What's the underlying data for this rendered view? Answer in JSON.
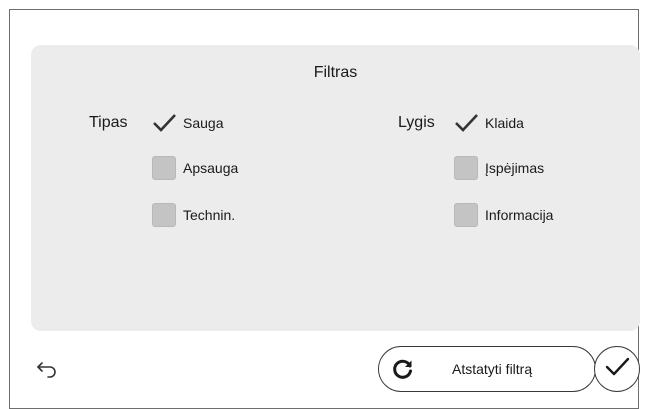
{
  "filter": {
    "title": "Filtras",
    "type_group": {
      "label": "Tipas",
      "options": [
        {
          "label": "Sauga",
          "checked": true
        },
        {
          "label": "Apsauga",
          "checked": false
        },
        {
          "label": "Technin.",
          "checked": false
        }
      ]
    },
    "level_group": {
      "label": "Lygis",
      "options": [
        {
          "label": "Klaida",
          "checked": true
        },
        {
          "label": "Įspėjimas",
          "checked": false
        },
        {
          "label": "Informacija",
          "checked": false
        }
      ]
    }
  },
  "footer": {
    "back_icon": "back-arrow-icon",
    "reset_label": "Atstatyti filtrą",
    "reset_icon": "refresh-icon",
    "confirm_icon": "checkmark-icon"
  },
  "colors": {
    "panel": "#ececec",
    "checkbox_off": "#c4c4c4",
    "border": "#3a3a3a"
  }
}
